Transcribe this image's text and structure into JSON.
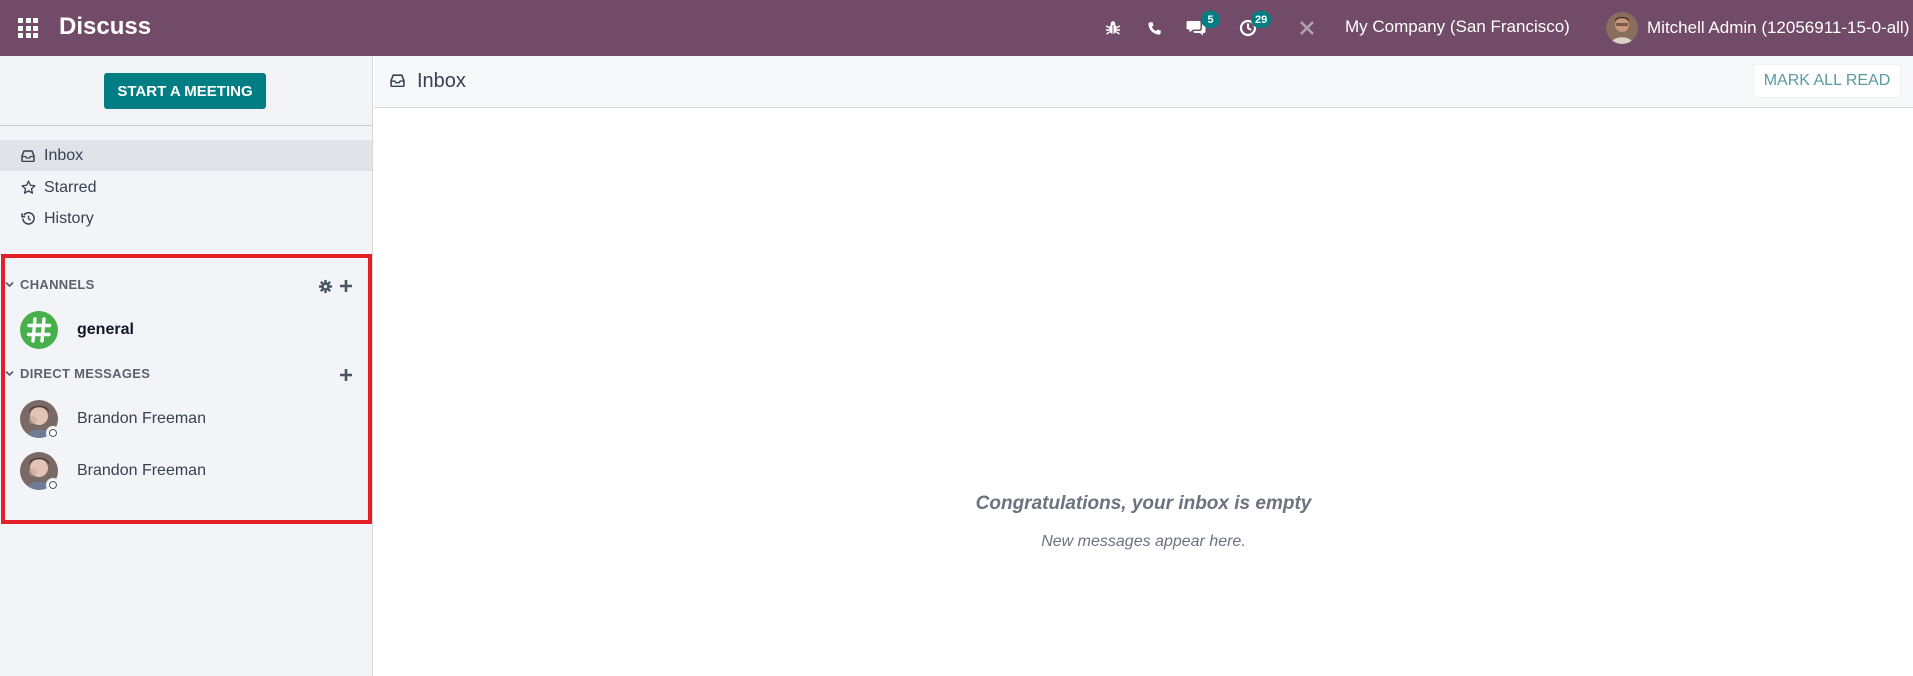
{
  "navbar": {
    "brand": "Discuss",
    "messages_count": "5",
    "activities_count": "29",
    "company": "My Company (San Francisco)",
    "user_name": "Mitchell Admin (12056911-15-0-all)",
    "icons": [
      "apps-grid-icon",
      "bug-icon",
      "phone-icon",
      "chat-icon",
      "clock-icon",
      "close-icon"
    ],
    "bg_color": "#714b67",
    "badge_color": "#017e84"
  },
  "sidebar": {
    "start_meeting_label": "START A MEETING",
    "mailboxes": [
      {
        "label": "Inbox",
        "icon": "inbox-icon",
        "active": true
      },
      {
        "label": "Starred",
        "icon": "star-icon",
        "active": false
      },
      {
        "label": "History",
        "icon": "history-icon",
        "active": false
      }
    ],
    "channels_header": "CHANNELS",
    "channels": [
      {
        "name": "general",
        "icon": "hashtag-icon",
        "color": "#48b04a"
      }
    ],
    "direct_messages_header": "DIRECT MESSAGES",
    "direct_messages": [
      {
        "name": "Brandon Freeman"
      },
      {
        "name": "Brandon Freeman"
      }
    ]
  },
  "main": {
    "title": "Inbox",
    "mark_all_read_label": "MARK ALL READ",
    "empty_title": "Congratulations, your inbox is empty",
    "empty_subtitle": "New messages appear here."
  }
}
